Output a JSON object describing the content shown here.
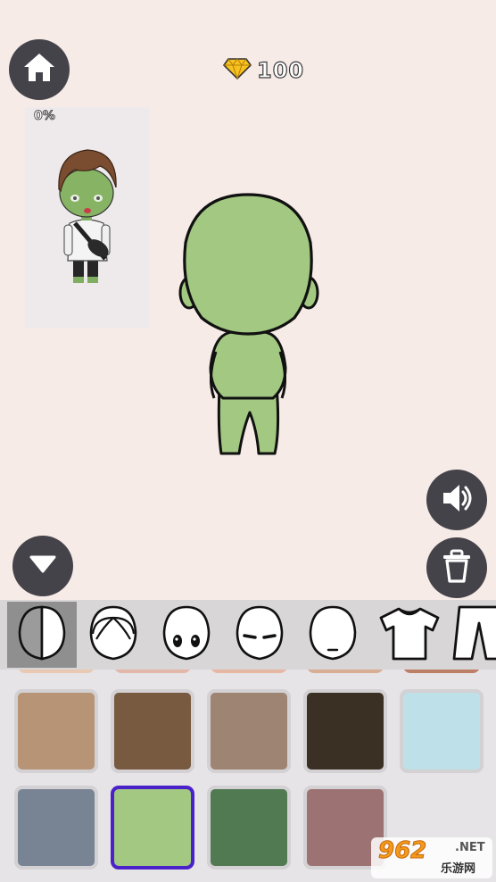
{
  "gems": {
    "count": "100",
    "icon": "yellow-diamond-icon",
    "color": "#f7c21e"
  },
  "preview": {
    "progress": "0%"
  },
  "buttons": {
    "home": "home-icon",
    "collapse": "triangle-down-icon",
    "sound": "speaker-icon",
    "trash": "trash-icon"
  },
  "categories": [
    {
      "name": "skin",
      "icon": "half-face-icon",
      "selected": true
    },
    {
      "name": "hair",
      "icon": "hair-icon",
      "selected": false
    },
    {
      "name": "eyes",
      "icon": "eyes-icon",
      "selected": false
    },
    {
      "name": "eyebrows",
      "icon": "eyebrows-icon",
      "selected": false
    },
    {
      "name": "mouth",
      "icon": "mouth-icon",
      "selected": false
    },
    {
      "name": "top",
      "icon": "tshirt-icon",
      "selected": false
    },
    {
      "name": "bottom",
      "icon": "pants-icon",
      "selected": false
    }
  ],
  "skin_tones": [
    {
      "color": "#b89476",
      "selected": false
    },
    {
      "color": "#785a40",
      "selected": false
    },
    {
      "color": "#9e8473",
      "selected": false
    },
    {
      "color": "#3a3023",
      "selected": false
    },
    {
      "color": "#bde0e9",
      "selected": false
    },
    {
      "color": "#788494",
      "selected": false
    },
    {
      "color": "#a2c882",
      "selected": true
    },
    {
      "color": "#517a52",
      "selected": false
    },
    {
      "color": "#9d7272",
      "selected": false
    }
  ],
  "avatar": {
    "skin": "#a2c882",
    "outline": "#1a1a1a"
  },
  "watermark": {
    "logo": "962",
    "site": ".NET",
    "sub": "乐游网"
  }
}
